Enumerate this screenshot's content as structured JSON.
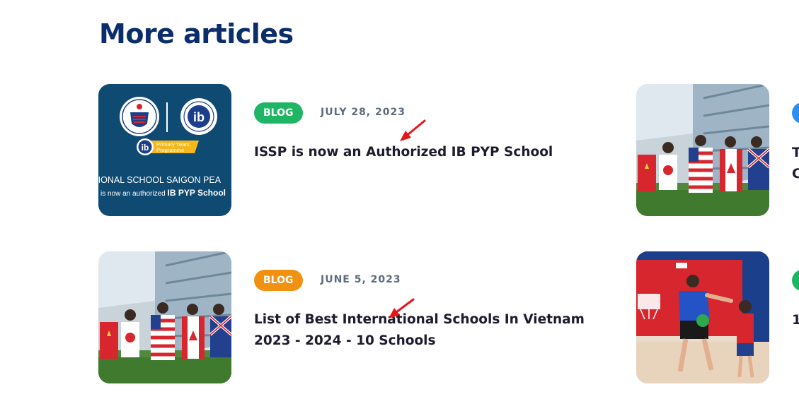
{
  "section": {
    "heading": "More articles"
  },
  "articles": [
    {
      "category": "BLOG",
      "category_color": "#1eb564",
      "date": "JULY 28, 2023",
      "title": "ISSP is now an Authorized IB PYP School",
      "thumbnail": {
        "kind": "ib-pyp-announcement",
        "program_label_1": "Primary Years",
        "program_label_2": "Programme",
        "caption_1": "TIONAL SCHOOL SAIGON PEA",
        "caption_2a": "is now an authorized ",
        "caption_2b": "IB PYP School"
      }
    },
    {
      "category": "BLOG",
      "category_color": "#f29111",
      "date": "JUNE 5, 2023",
      "title": "List of Best International Schools In Vietnam 2023 - 2024 - 10 Schools",
      "thumbnail": {
        "kind": "students-with-flags"
      }
    }
  ],
  "right_column": [
    {
      "badge_color": "#2d8ef0",
      "title_fragment_1": "T",
      "title_fragment_2": "C",
      "thumbnail": {
        "kind": "students-with-flags"
      }
    },
    {
      "badge_color": "#1eb564",
      "title_fragment_1": "1",
      "thumbnail": {
        "kind": "coach-and-child-basketball"
      }
    }
  ],
  "annotation_color": "#e8141b"
}
